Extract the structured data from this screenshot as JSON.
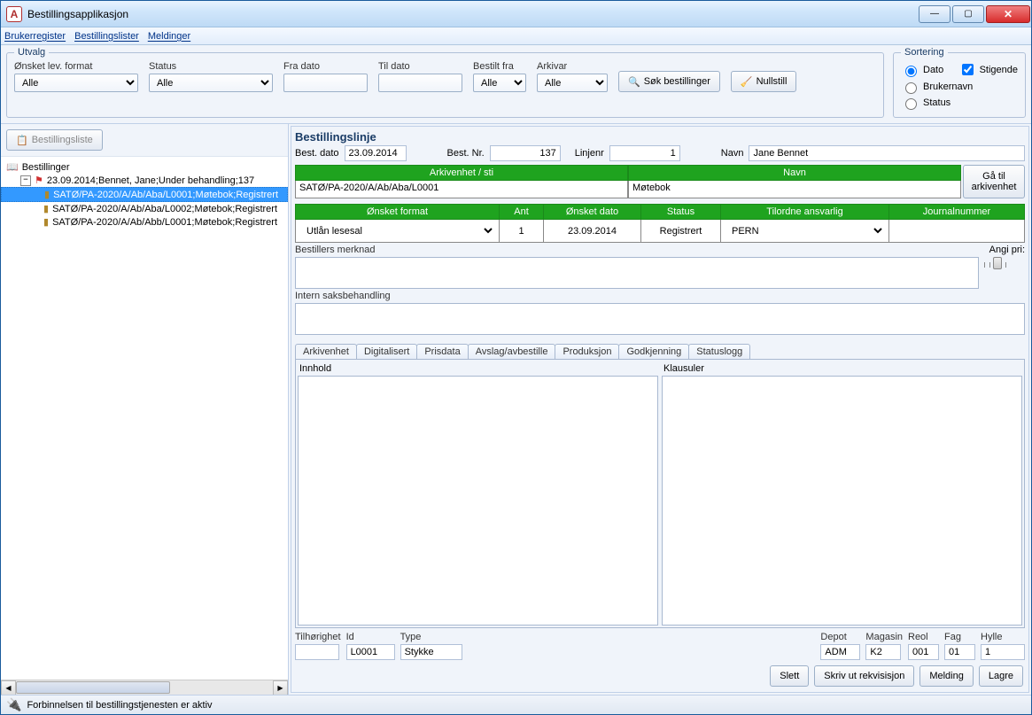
{
  "window": {
    "title": "Bestillingsapplikasjon",
    "app_icon_letter": "A"
  },
  "menu": {
    "items": [
      "Brukerregister",
      "Bestillingslister",
      "Meldinger"
    ]
  },
  "utvalg": {
    "legend": "Utvalg",
    "columns": {
      "format_label": "Ønsket lev. format",
      "format_value": "Alle",
      "status_label": "Status",
      "status_value": "Alle",
      "fra_dato_label": "Fra dato",
      "fra_dato_value": "",
      "til_dato_label": "Til dato",
      "til_dato_value": "",
      "bestilt_fra_label": "Bestilt fra",
      "bestilt_fra_value": "Alle",
      "arkivar_label": "Arkivar",
      "arkivar_value": "Alle"
    },
    "sok_btn": "Søk bestillinger",
    "nullstill_btn": "Nullstill",
    "sortering": {
      "legend": "Sortering",
      "dato": "Dato",
      "brukernavn": "Brukernavn",
      "status": "Status",
      "stigende": "Stigende",
      "selected": "Dato",
      "stigende_checked": true
    }
  },
  "sidebar": {
    "toolbar_btn": "Bestillingsliste",
    "root_label": "Bestillinger",
    "order_node": "23.09.2014;Bennet, Jane;Under behandling;137",
    "leaves": [
      "SATØ/PA-2020/A/Ab/Aba/L0001;Møtebok;Registrert",
      "SATØ/PA-2020/A/Ab/Aba/L0002;Møtebok;Registrert",
      "SATØ/PA-2020/A/Ab/Abb/L0001;Møtebok;Registrert"
    ],
    "selected_index": 0
  },
  "bestillingslinje": {
    "title": "Bestillingslinje",
    "best_dato_lbl": "Best. dato",
    "best_dato": "23.09.2014",
    "best_nr_lbl": "Best. Nr.",
    "best_nr": "137",
    "linjenr_lbl": "Linjenr",
    "linjenr": "1",
    "navn_lbl": "Navn",
    "navn": "Jane Bennet",
    "arkivenhet_sti_header": "Arkivenhet / sti",
    "navn_header": "Navn",
    "arkivenhet_sti": "SATØ/PA-2020/A/Ab/Aba/L0001",
    "arkivenhet_navn": "Møtebok",
    "ga_til_btn": "Gå til arkivenhet",
    "headers": {
      "format": "Ønsket format",
      "ant": "Ant",
      "dato": "Ønsket dato",
      "status": "Status",
      "ansvarlig": "Tilordne ansvarlig",
      "journalnummer": "Journalnummer"
    },
    "row": {
      "format": "Utlån lesesal",
      "ant": "1",
      "dato": "23.09.2014",
      "status": "Registrert",
      "ansvarlig": "PERN",
      "journalnummer": ""
    },
    "bestillers_merknad_lbl": "Bestillers merknad",
    "intern_lbl": "Intern saksbehandling",
    "angi_pri_lbl": "Angi pri:"
  },
  "tabs": {
    "items": [
      "Arkivenhet",
      "Digitalisert",
      "Prisdata",
      "Avslag/avbestille",
      "Produksjon",
      "Godkjenning",
      "Statuslogg"
    ],
    "active": 0,
    "innhold_lbl": "Innhold",
    "klausuler_lbl": "Klausuler"
  },
  "tilhorighet": {
    "tilhorighet_lbl": "Tilhørighet",
    "tilhorighet": "",
    "id_lbl": "Id",
    "id": "L0001",
    "type_lbl": "Type",
    "type": "Stykke",
    "depot_lbl": "Depot",
    "depot": "ADM",
    "magasin_lbl": "Magasin",
    "magasin": "K2",
    "reol_lbl": "Reol",
    "reol": "001",
    "fag_lbl": "Fag",
    "fag": "01",
    "hylle_lbl": "Hylle",
    "hylle": "1"
  },
  "buttons": {
    "slett": "Slett",
    "skriv_ut": "Skriv ut rekvisisjon",
    "melding": "Melding",
    "lagre": "Lagre"
  },
  "statusbar": {
    "text": "Forbinnelsen til bestillingstjenesten er aktiv"
  }
}
